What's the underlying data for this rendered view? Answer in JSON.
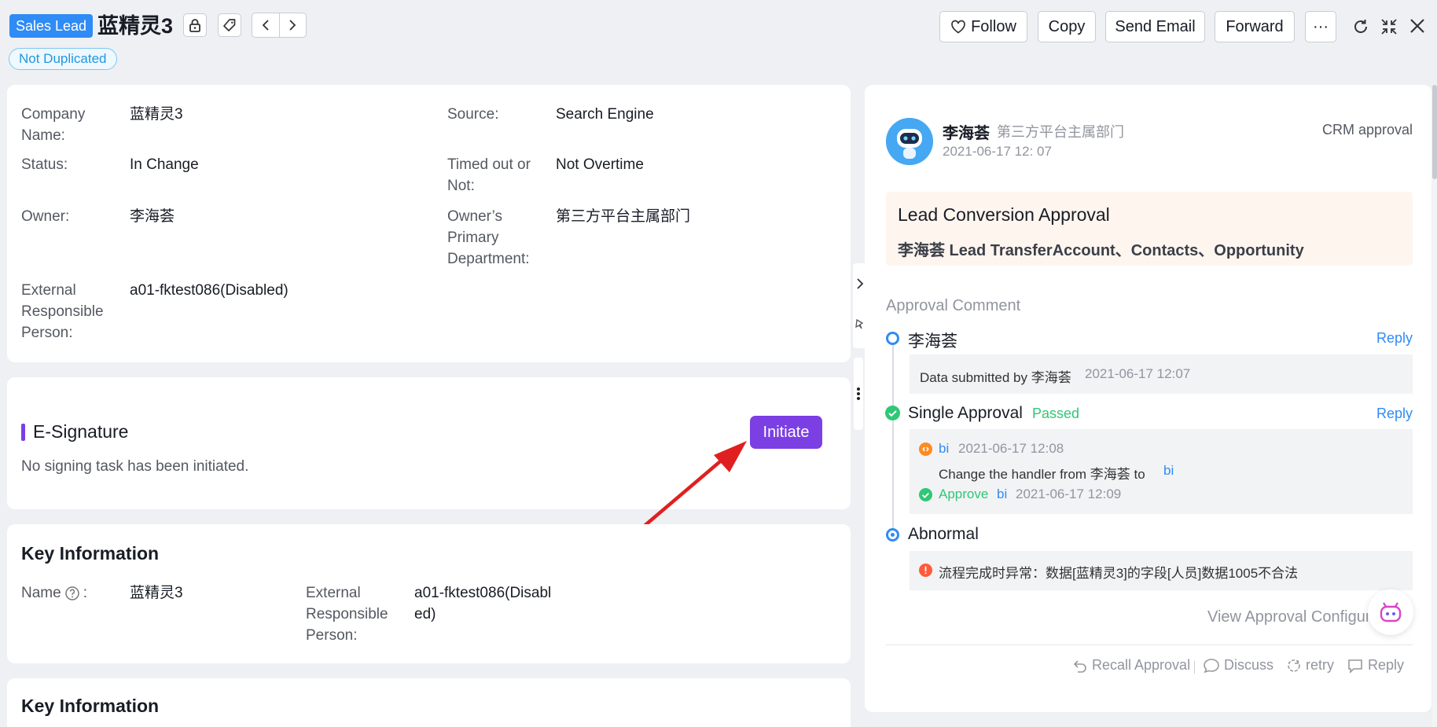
{
  "header": {
    "badge": "Sales Lead",
    "title": "蓝精灵3",
    "tag": "Not Duplicated",
    "buttons": {
      "follow": "Follow",
      "copy": "Copy",
      "send_email": "Send Email",
      "forward": "Forward",
      "more": "···"
    }
  },
  "basic": {
    "company_label": "Company Name:",
    "company_value": "蓝精灵3",
    "source_label": "Source:",
    "source_value": "Search Engine",
    "status_label": "Status:",
    "status_value": "In Change",
    "timeout_label": "Timed out or Not:",
    "timeout_value": "Not Overtime",
    "owner_label": "Owner:",
    "owner_value": "李海荟",
    "dept_label": "Owner’s Primary Department:",
    "dept_value": "第三方平台主属部门",
    "ext_label": "External Responsible Person:",
    "ext_value": "a01-fktest086(Disabled)"
  },
  "esign": {
    "title": "E-Signature",
    "empty": "No signing task has been initiated.",
    "button": "Initiate"
  },
  "key_info": {
    "title": "Key Information",
    "name_label": "Name",
    "name_value": "蓝精灵3",
    "ext_label": "External Responsible Person:",
    "ext_value": "a01-fktest086(Disabled)"
  },
  "key_info2": {
    "title": "Key Information"
  },
  "approval": {
    "user": "李海荟",
    "dept": "第三方平台主属部门",
    "time": "2021-06-17 12: 07",
    "type": "CRM approval",
    "box_title": "Lead Conversion Approval",
    "box_text": "李海荟 Lead TransferAccount、Contacts、Opportunity",
    "comment_title": "Approval Comment",
    "steps": {
      "s1_name": "李海荟",
      "s1_detail": "Data submitted by 李海荟",
      "s1_time": "2021-06-17 12:07",
      "reply": "Reply",
      "s2_name": "Single Approval",
      "s2_status": "Passed",
      "s2_user": "bi",
      "s2_time": "2021-06-17 12:08",
      "s2_change_text": "Change the handler from 李海荟 to",
      "s2_change_to": "bi",
      "s2_approve": "Approve",
      "s2_approve_user": "bi",
      "s2_approve_time": "2021-06-17 12:09",
      "s3_name": "Abnormal",
      "s3_error": "流程完成时异常：数据[蓝精灵3]的字段[人员]数据1005不合法"
    },
    "view_config": "View Approval Configura",
    "actions": {
      "recall": "Recall Approval",
      "discuss": "Discuss",
      "retry": "retry",
      "reply": "Reply"
    }
  }
}
